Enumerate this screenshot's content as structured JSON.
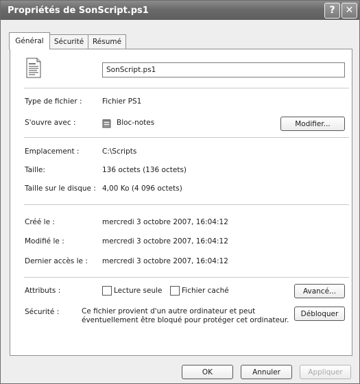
{
  "window": {
    "title": "Propriétés de SonScript.ps1",
    "help_glyph": "?",
    "close_glyph": "✕"
  },
  "tabs": [
    {
      "label": "Général",
      "active": true
    },
    {
      "label": "Sécurité",
      "active": false
    },
    {
      "label": "Résumé",
      "active": false
    }
  ],
  "file": {
    "icon": "text-file-icon",
    "name": "SonScript.ps1"
  },
  "type_section": {
    "type_label": "Type de fichier :",
    "type_value": "Fichier PS1",
    "opens_with_label": "S'ouvre avec :",
    "opens_with_icon": "notepad-icon",
    "opens_with_value": "Bloc-notes",
    "modify_button": "Modifier..."
  },
  "location_section": {
    "location_label": "Emplacement :",
    "location_value": "C:\\Scripts",
    "size_label": "Taille:",
    "size_value": "136 octets (136 octets)",
    "disk_size_label": "Taille sur le disque :",
    "disk_size_value": "4,00 Ko (4 096 octets)"
  },
  "dates_section": {
    "created_label": "Créé le :",
    "created_value": "mercredi 3 octobre 2007, 16:04:12",
    "modified_label": "Modifié le :",
    "modified_value": "mercredi 3 octobre 2007, 16:04:12",
    "accessed_label": "Dernier accès le :",
    "accessed_value": "mercredi 3 octobre 2007, 16:04:12"
  },
  "attributes_section": {
    "attributes_label": "Attributs :",
    "readonly_label": "Lecture seule",
    "readonly_checked": false,
    "hidden_label": "Fichier caché",
    "hidden_checked": false,
    "advanced_button": "Avancé...",
    "security_label": "Sécurité :",
    "security_line1": "Ce fichier provient d'un autre ordinateur et peut",
    "security_line2": "éventuellement être bloqué pour protéger cet ordinateur.",
    "unblock_button": "Débloquer"
  },
  "footer": {
    "ok_button": "OK",
    "cancel_button": "Annuler",
    "apply_button": "Appliquer"
  }
}
